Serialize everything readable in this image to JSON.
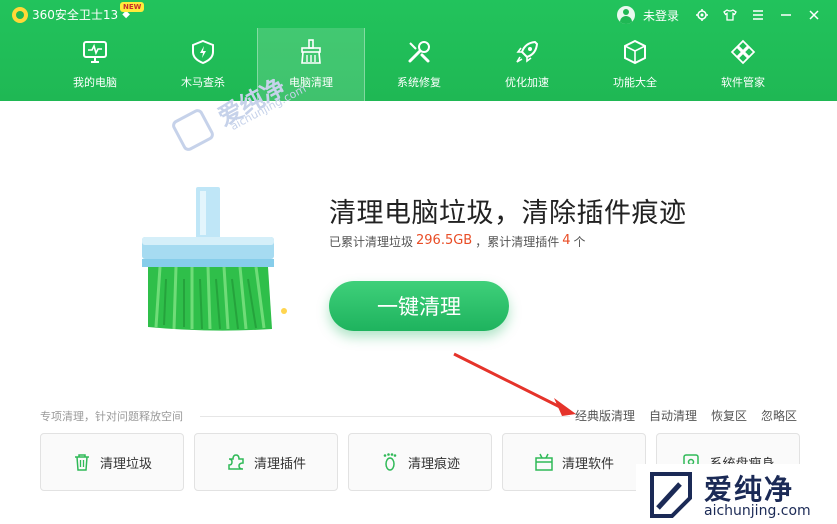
{
  "window": {
    "title": "360安全卫士13",
    "badge": "NEW",
    "user_label": "未登录"
  },
  "nav": {
    "items": [
      {
        "label": "我的电脑",
        "icon": "monitor-icon"
      },
      {
        "label": "木马查杀",
        "icon": "shield-bolt-icon"
      },
      {
        "label": "电脑清理",
        "icon": "broom-icon",
        "active": true
      },
      {
        "label": "系统修复",
        "icon": "wrench-icon"
      },
      {
        "label": "优化加速",
        "icon": "rocket-icon"
      },
      {
        "label": "功能大全",
        "icon": "cube-icon"
      },
      {
        "label": "软件管家",
        "icon": "grid-icon"
      }
    ]
  },
  "hero": {
    "title": "清理电脑垃圾，清除插件痕迹",
    "sub_prefix": "已累计清理垃圾",
    "junk_value": "296.5GB",
    "sub_middle": "，累计清理插件",
    "plugin_count": "4",
    "sub_suffix": "个",
    "button_label": "一键清理"
  },
  "watermark": {
    "cn": "爱纯净",
    "en": "aichunjing.com"
  },
  "special": {
    "label": "专项清理，针对问题释放空间",
    "links": [
      "经典版清理",
      "自动清理",
      "恢复区",
      "忽略区"
    ]
  },
  "tools": [
    {
      "label": "清理垃圾",
      "icon": "trash-icon"
    },
    {
      "label": "清理插件",
      "icon": "puzzle-icon"
    },
    {
      "label": "清理痕迹",
      "icon": "footprint-icon"
    },
    {
      "label": "清理软件",
      "icon": "box-icon"
    },
    {
      "label": "系统盘瘦身",
      "icon": "disk-icon"
    }
  ],
  "colors": {
    "brand_green": "#1fb854",
    "highlight": "#e94d26",
    "arrow_red": "#e5332a"
  }
}
